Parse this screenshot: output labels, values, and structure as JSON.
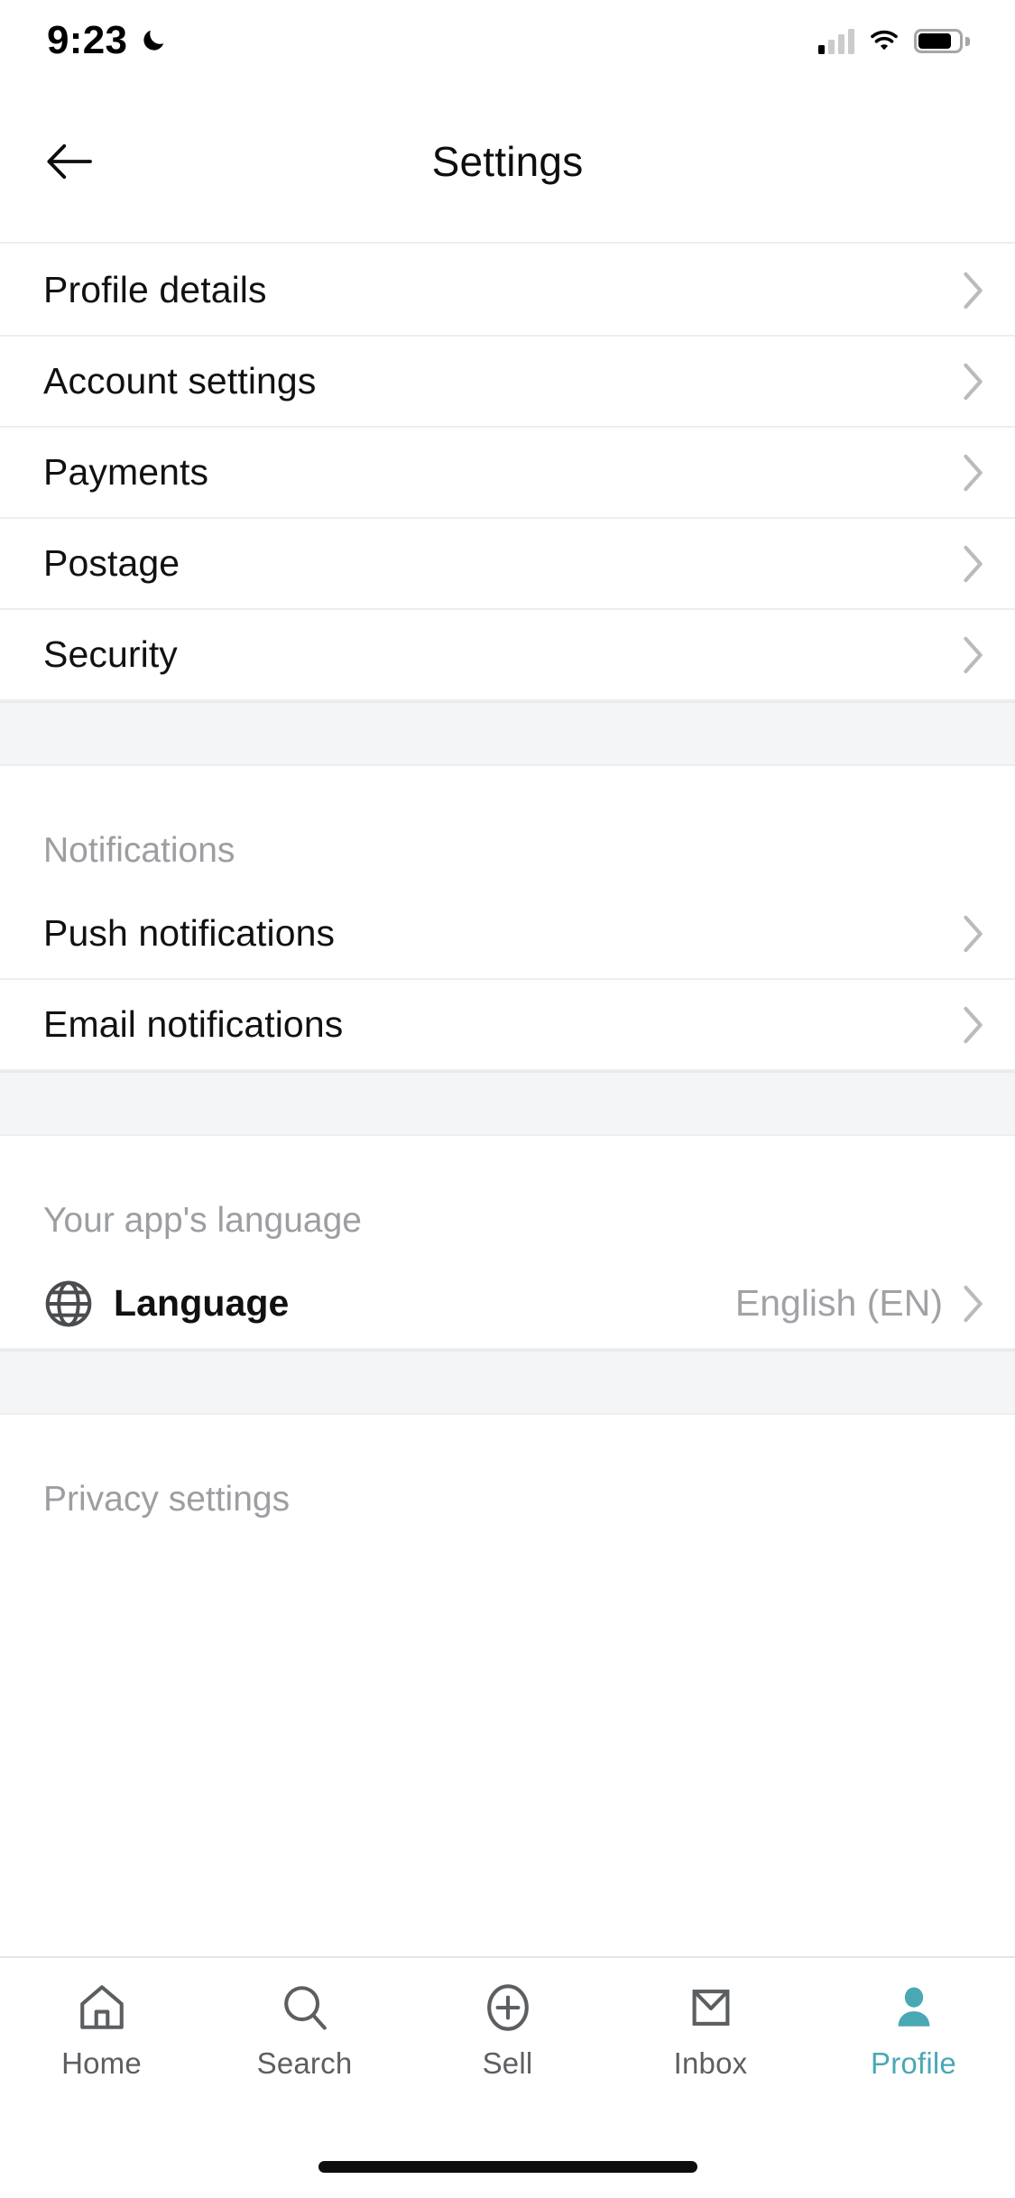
{
  "status_bar": {
    "time": "9:23",
    "dnd_icon": "crescent-moon-icon",
    "signal_icon": "cellular-signal-icon",
    "signal_bars_filled": 1,
    "signal_bars_total": 4,
    "wifi_icon": "wifi-icon",
    "battery_icon": "battery-icon",
    "battery_level_percent": 82
  },
  "header": {
    "back_icon": "arrow-left-icon",
    "title": "Settings"
  },
  "sections": [
    {
      "id": "account",
      "title": "",
      "rows": [
        {
          "label": "Profile details",
          "value": "",
          "icon": "",
          "chevron": "chevron-right-icon"
        },
        {
          "label": "Account settings",
          "value": "",
          "icon": "",
          "chevron": "chevron-right-icon"
        },
        {
          "label": "Payments",
          "value": "",
          "icon": "",
          "chevron": "chevron-right-icon"
        },
        {
          "label": "Postage",
          "value": "",
          "icon": "",
          "chevron": "chevron-right-icon"
        },
        {
          "label": "Security",
          "value": "",
          "icon": "",
          "chevron": "chevron-right-icon"
        }
      ]
    },
    {
      "id": "notifications",
      "title": "Notifications",
      "rows": [
        {
          "label": "Push notifications",
          "value": "",
          "icon": "",
          "chevron": "chevron-right-icon"
        },
        {
          "label": "Email notifications",
          "value": "",
          "icon": "",
          "chevron": "chevron-right-icon"
        }
      ]
    },
    {
      "id": "language",
      "title": "Your app's language",
      "rows": [
        {
          "label": "Language",
          "value": "English (EN)",
          "icon": "globe-icon",
          "chevron": "chevron-right-icon"
        }
      ]
    },
    {
      "id": "privacy",
      "title": "Privacy settings",
      "rows": []
    }
  ],
  "tab_bar": {
    "active": "Profile",
    "accent_color": "#4aa8b5",
    "inactive_color": "#5c5f62",
    "tabs": [
      {
        "label": "Home",
        "icon": "home-icon"
      },
      {
        "label": "Search",
        "icon": "search-icon"
      },
      {
        "label": "Sell",
        "icon": "plus-circle-icon"
      },
      {
        "label": "Inbox",
        "icon": "envelope-icon"
      },
      {
        "label": "Profile",
        "icon": "person-icon"
      }
    ]
  },
  "colors": {
    "background": "#ffffff",
    "band": "#f4f5f6",
    "divider": "#edeef0",
    "text_primary": "#111111",
    "text_muted": "#9c9ea1",
    "accent": "#4aa8b5"
  }
}
